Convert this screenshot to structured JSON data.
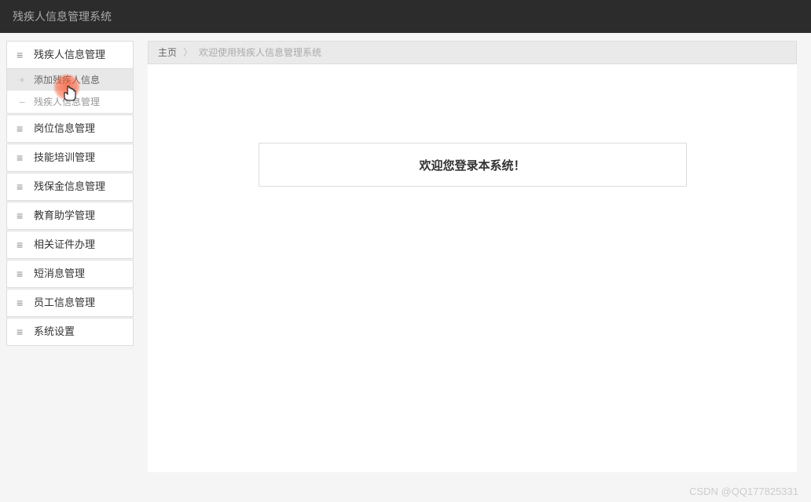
{
  "header": {
    "title": "残疾人信息管理系统"
  },
  "sidebar": {
    "groups": [
      {
        "label": "残疾人信息管理",
        "icon": "≡",
        "expanded": true,
        "items": [
          {
            "label": "添加残疾人信息",
            "icon": "+",
            "hover": true
          },
          {
            "label": "残疾人信息管理",
            "icon": "–",
            "hover": false
          }
        ]
      },
      {
        "label": "岗位信息管理",
        "icon": "≡",
        "expanded": false
      },
      {
        "label": "技能培训管理",
        "icon": "≡",
        "expanded": false
      },
      {
        "label": "残保金信息管理",
        "icon": "≡",
        "expanded": false
      },
      {
        "label": "教育助学管理",
        "icon": "≡",
        "expanded": false
      },
      {
        "label": "相关证件办理",
        "icon": "≡",
        "expanded": false
      },
      {
        "label": "短消息管理",
        "icon": "≡",
        "expanded": false
      },
      {
        "label": "员工信息管理",
        "icon": "≡",
        "expanded": false
      },
      {
        "label": "系统设置",
        "icon": "≡",
        "expanded": false
      }
    ]
  },
  "breadcrumb": {
    "home": "主页",
    "current": "欢迎使用残疾人信息管理系统"
  },
  "main": {
    "welcome": "欢迎您登录本系统！"
  },
  "watermark": "CSDN @QQ177825331"
}
